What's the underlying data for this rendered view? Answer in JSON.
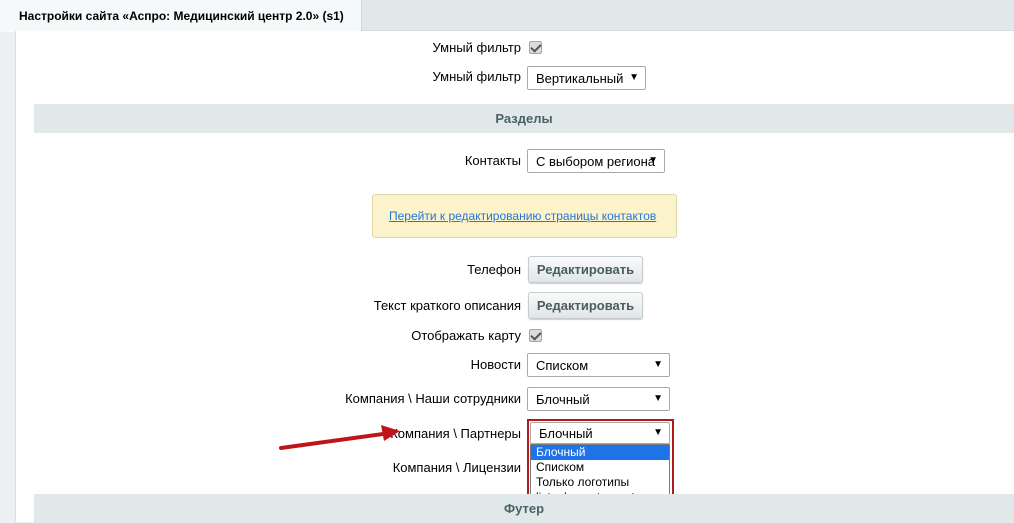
{
  "window": {
    "tab_title": "Настройки сайта «Аспро: Медицинский центр 2.0» (s1)"
  },
  "rows": {
    "smart_filter_check_label": "Умный фильтр",
    "smart_filter_select_label": "Умный фильтр",
    "smart_filter_select_value": "Вертикальный",
    "contacts_label": "Контакты",
    "contacts_value": "С выбором региона",
    "contacts_link": "Перейти к редактированию страницы контактов",
    "phone_label": "Телефон",
    "phone_button": "Редактировать",
    "short_desc_label": "Текст краткого описания",
    "short_desc_button": "Редактировать",
    "show_map_label": "Отображать карту",
    "news_label": "Новости",
    "news_value": "Списком",
    "staff_label": "Компания \\ Наши сотрудники",
    "staff_value": "Блочный",
    "partners_label": "Компания \\ Партнеры",
    "partners_value": "Блочный",
    "licenses_label": "Компания \\ Лицензии"
  },
  "sections": {
    "sections_title": "Разделы",
    "footer_title": "Футер"
  },
  "dropdown_options": [
    "Блочный",
    "Списком",
    "Только логотипы",
    "list_elements_custom"
  ],
  "colors": {
    "highlight_frame": "#b01a1a",
    "selected_option": "#1e73e8",
    "arrow": "#c0141a"
  }
}
